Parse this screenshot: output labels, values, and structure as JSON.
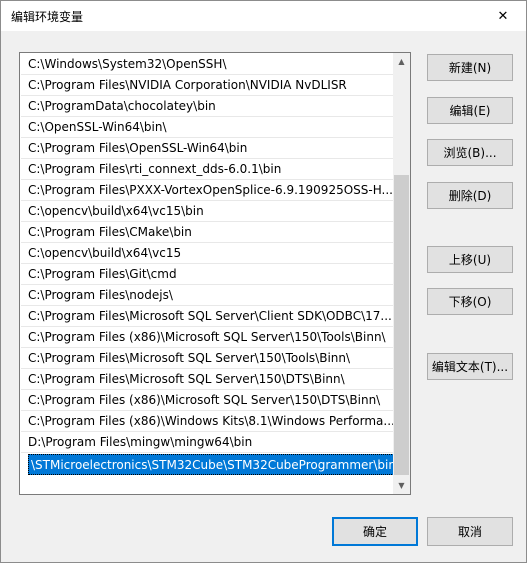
{
  "window": {
    "title": "编辑环境变量",
    "close_glyph": "✕"
  },
  "path_list": {
    "items": [
      "C:\\Windows\\System32\\OpenSSH\\",
      "C:\\Program Files\\NVIDIA Corporation\\NVIDIA NvDLISR",
      "C:\\ProgramData\\chocolatey\\bin",
      "C:\\OpenSSL-Win64\\bin\\",
      "C:\\Program Files\\OpenSSL-Win64\\bin",
      "C:\\Program Files\\rti_connext_dds-6.0.1\\bin",
      "C:\\Program Files\\PXXX-VortexOpenSplice-6.9.190925OSS-H...",
      "C:\\opencv\\build\\x64\\vc15\\bin",
      "C:\\Program Files\\CMake\\bin",
      "C:\\opencv\\build\\x64\\vc15",
      "C:\\Program Files\\Git\\cmd",
      "C:\\Program Files\\nodejs\\",
      "C:\\Program Files\\Microsoft SQL Server\\Client SDK\\ODBC\\17...",
      "C:\\Program Files (x86)\\Microsoft SQL Server\\150\\Tools\\Binn\\",
      "C:\\Program Files\\Microsoft SQL Server\\150\\Tools\\Binn\\",
      "C:\\Program Files\\Microsoft SQL Server\\150\\DTS\\Binn\\",
      "C:\\Program Files (x86)\\Microsoft SQL Server\\150\\DTS\\Binn\\",
      "C:\\Program Files (x86)\\Windows Kits\\8.1\\Windows Performa...",
      "D:\\Program Files\\mingw\\mingw64\\bin"
    ],
    "selected_item_value": "\\STMicroelectronics\\STM32Cube\\STM32CubeProgrammer\\bin",
    "scroll_up_glyph": "▲",
    "scroll_down_glyph": "▼"
  },
  "buttons": {
    "new": "新建(N)",
    "edit": "编辑(E)",
    "browse": "浏览(B)...",
    "delete": "删除(D)",
    "move_up": "上移(U)",
    "move_down": "下移(O)",
    "edit_text": "编辑文本(T)...",
    "ok": "确定",
    "cancel": "取消"
  },
  "colors": {
    "selection": "#0078d7",
    "default_button_border": "#0078d7",
    "dialog_bg": "#f0f0f0"
  }
}
